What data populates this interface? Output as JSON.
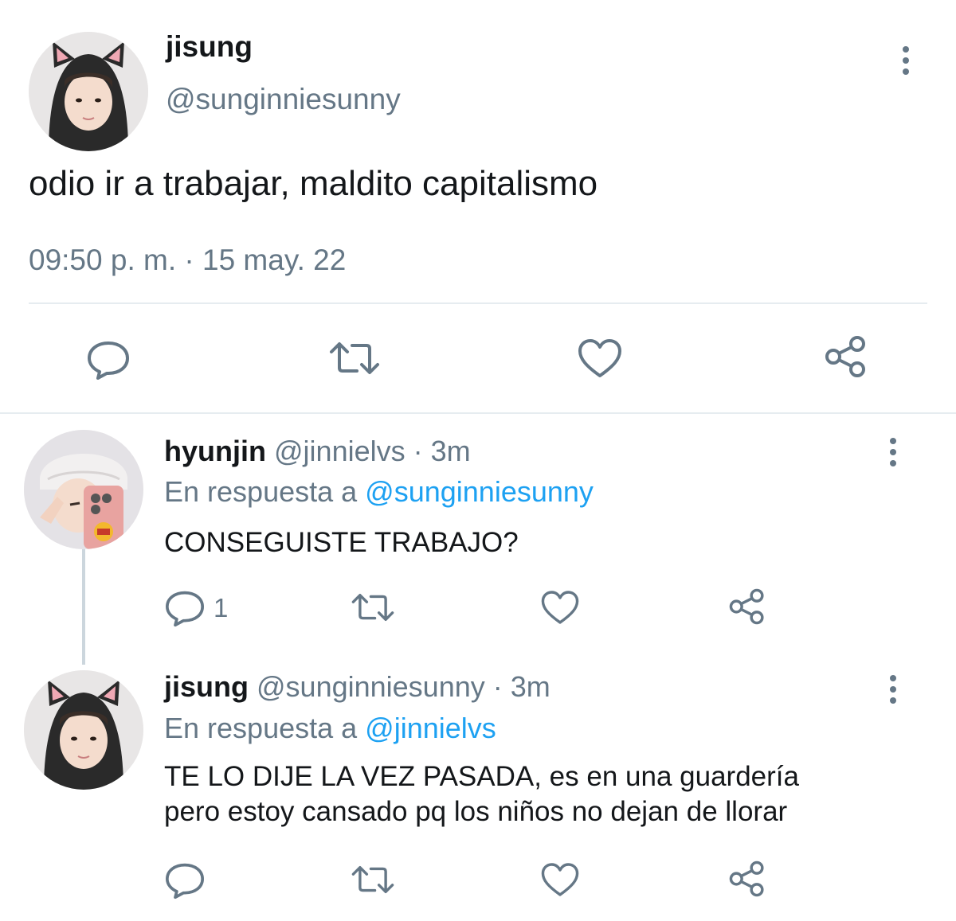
{
  "main_tweet": {
    "name": "jisung",
    "handle": "@sunginniesunny",
    "text": "odio ir a trabajar, maldito capitalismo",
    "timestamp": "09:50 p. m. · 15 may. 22"
  },
  "replies": [
    {
      "name": "hyunjin",
      "meta": " @jinnielvs · 3m",
      "in_reply_prefix": "En respuesta a ",
      "in_reply_mention": "@sunginniesunny",
      "text_line1": "CONSEGUISTE TRABAJO?",
      "text_line2": "",
      "reply_count": "1"
    },
    {
      "name": "jisung",
      "meta": " @sunginniesunny · 3m",
      "in_reply_prefix": "En respuesta a ",
      "in_reply_mention": "@jinnielvs",
      "text_line1": "TE LO DIJE LA VEZ PASADA, es en una guardería",
      "text_line2": "pero estoy cansado pq los niños no dejan de llorar",
      "reply_count": ""
    }
  ],
  "icons": {
    "reply": "reply-icon",
    "retweet": "retweet-icon",
    "like": "heart-icon",
    "share": "share-icon",
    "more": "more-vertical-icon"
  },
  "colors": {
    "text": "#14171a",
    "muted": "#657786",
    "link": "#1da1f2",
    "divider": "#e6ecf0"
  }
}
